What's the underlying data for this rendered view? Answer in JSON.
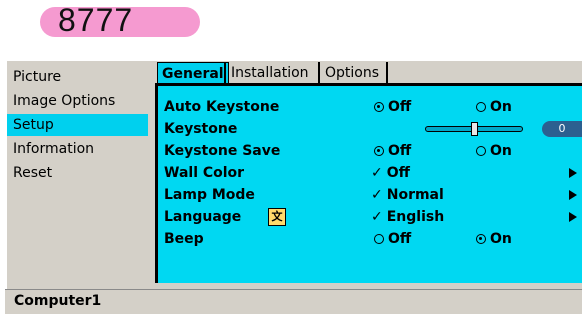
{
  "header": {
    "code": "8777"
  },
  "sidebar": {
    "items": [
      {
        "label": "Picture"
      },
      {
        "label": "Image Options"
      },
      {
        "label": "Setup"
      },
      {
        "label": "Information"
      },
      {
        "label": "Reset"
      }
    ],
    "selected": "Setup"
  },
  "tabs": [
    {
      "label": "General"
    },
    {
      "label": "Installation"
    },
    {
      "label": "Options"
    }
  ],
  "settings": {
    "auto_keystone": {
      "label": "Auto Keystone",
      "off": "Off",
      "on": "On",
      "selected": "Off"
    },
    "keystone": {
      "label": "Keystone",
      "value": "0"
    },
    "keystone_save": {
      "label": "Keystone Save",
      "off": "Off",
      "on": "On",
      "selected": "Off"
    },
    "wall_color": {
      "label": "Wall Color",
      "value": "Off"
    },
    "lamp_mode": {
      "label": "Lamp Mode",
      "value": "Normal"
    },
    "language": {
      "label": "Language",
      "icon": "language-icon",
      "value": "English"
    },
    "beep": {
      "label": "Beep",
      "off": "Off",
      "on": "On",
      "selected": "On"
    }
  },
  "status": {
    "source": "Computer1"
  },
  "colors": {
    "accent": "#00d8f2",
    "pill": "#f59ad0",
    "badge": "#2c6090",
    "window": "#d4d0c8"
  }
}
